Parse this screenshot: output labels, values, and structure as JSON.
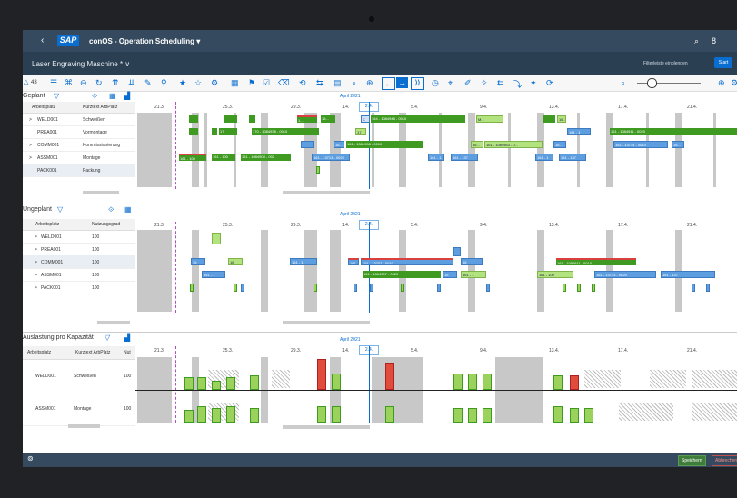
{
  "window": {
    "back_glyph": "‹",
    "logo": "SAP",
    "title": "conOS - Operation Scheduling ▾"
  },
  "header_icons": {
    "search": "⌕",
    "user": "8"
  },
  "subheader": {
    "variant": "Laser Engraving Maschine * ∨",
    "filter_toggle": "Filterleiste einblenden",
    "start_button": "Start"
  },
  "toolbar": {
    "count": "43",
    "icons": [
      "bell-icon",
      "list-icon",
      "binoculars-icon",
      "minus-circle-icon",
      "refresh-icon",
      "expand-icon",
      "collapse-icon",
      "edit-icon",
      "link-icon",
      "star-icon",
      "star-outline-icon",
      "settings-icon",
      "calendar-icon",
      "flag-icon",
      "checkbox-icon",
      "delete-icon",
      "undo-icon",
      "reschedule-icon",
      "grid-icon",
      "search-icon"
    ],
    "nav": {
      "prev": "←",
      "next": "→",
      "end": "⟩⟩"
    }
  },
  "timeline": {
    "month": "April 2021",
    "today": "2.4.",
    "dates": [
      "21.3.",
      "25.3.",
      "29.3.",
      "1.4.",
      "5.4.",
      "9.4.",
      "13.4.",
      "17.4.",
      "21.4."
    ]
  },
  "geplant": {
    "title": "Geplant",
    "col_headers": [
      "Arbeitsplatz",
      "Kurztext ArbPlatz"
    ],
    "rows": [
      {
        "expander": ">",
        "id": "WELD001",
        "text": "Schweißen"
      },
      {
        "expander": "",
        "id": "PREA001",
        "text": "Vormontage"
      },
      {
        "expander": ">",
        "id": "COMM001",
        "text": "Kommissionierung"
      },
      {
        "expander": ">",
        "id": "ASSM001",
        "text": "Montage"
      },
      {
        "expander": "",
        "id": "PACK001",
        "text": "Packung"
      }
    ],
    "bar_labels": {
      "b1": "1...",
      "b2": "16...",
      "b3": "X",
      "b4": "164 - 1084948 - 0010",
      "b5": "M...",
      "b6": "16...",
      "b7": "17",
      "b8": "170 - 1084938 - 0010",
      "b9": "17",
      "b10": "161 - 1",
      "b11": "161 - 1084911 - 0020",
      "b12": "16...",
      "b13": "161 - 1084958 - 0010",
      "b14": "16...",
      "b15": "161 - 1084963 - 0...",
      "b16": "16...",
      "b17": "161 - 13714 - 0010",
      "b18": "16...",
      "b19": "161 - 100",
      "b20": "161 - 100",
      "b21": "161 - 1084908 - 002",
      "b22": "161 - 13713 - 0020",
      "b23": "161 - 1",
      "b24": "161 - 137",
      "b25": "161 - 1",
      "b26": "161 - 137"
    }
  },
  "ungeplant": {
    "title": "Ungeplant",
    "col_headers": [
      "Arbeitsplatz",
      "Nutzungsgrad"
    ],
    "rows": [
      {
        "expander": ">",
        "id": "WELD001",
        "value": "100"
      },
      {
        "expander": ">",
        "id": "PREA001",
        "value": "100"
      },
      {
        "expander": ">",
        "id": "COMM001",
        "value": "100"
      },
      {
        "expander": ">",
        "id": "ASSM001",
        "value": "100"
      },
      {
        "expander": ">",
        "id": "PACK001",
        "value": "100"
      }
    ],
    "bar_labels": {
      "u1": "16",
      "u2": "16",
      "u3": "161 - 1",
      "u4": "161 - 1",
      "u5": "161 - 13707 - 0010",
      "u6": "16",
      "u7": "161 - 1084911 - 0010",
      "u8": "161 - 1",
      "u9": "161 - 1084957 - 0020",
      "u10": "16",
      "u11": "161 - 1",
      "u12": "161 - 100",
      "u13": "161 - 13713 - 0020",
      "u14": "161 - 137"
    }
  },
  "auslastung": {
    "title": "Auslastung pro Kapazität",
    "col_headers": [
      "Arbeitsplatz",
      "Kurztext ArbPlatz",
      "Nut"
    ],
    "rows": [
      {
        "id": "WELD001",
        "text": "Schweißen",
        "value": "100"
      },
      {
        "id": "ASSM001",
        "text": "Montage",
        "value": "100"
      }
    ]
  },
  "footer": {
    "save": "Speichern",
    "cancel": "Abbrechen"
  },
  "colors": {
    "shell": "#354a5f",
    "accent": "#0a6ed1",
    "planned": "#3f9a21",
    "light_planned": "#b2e37f",
    "unplanned": "#5d9ee0",
    "overload": "#e04c3c"
  }
}
